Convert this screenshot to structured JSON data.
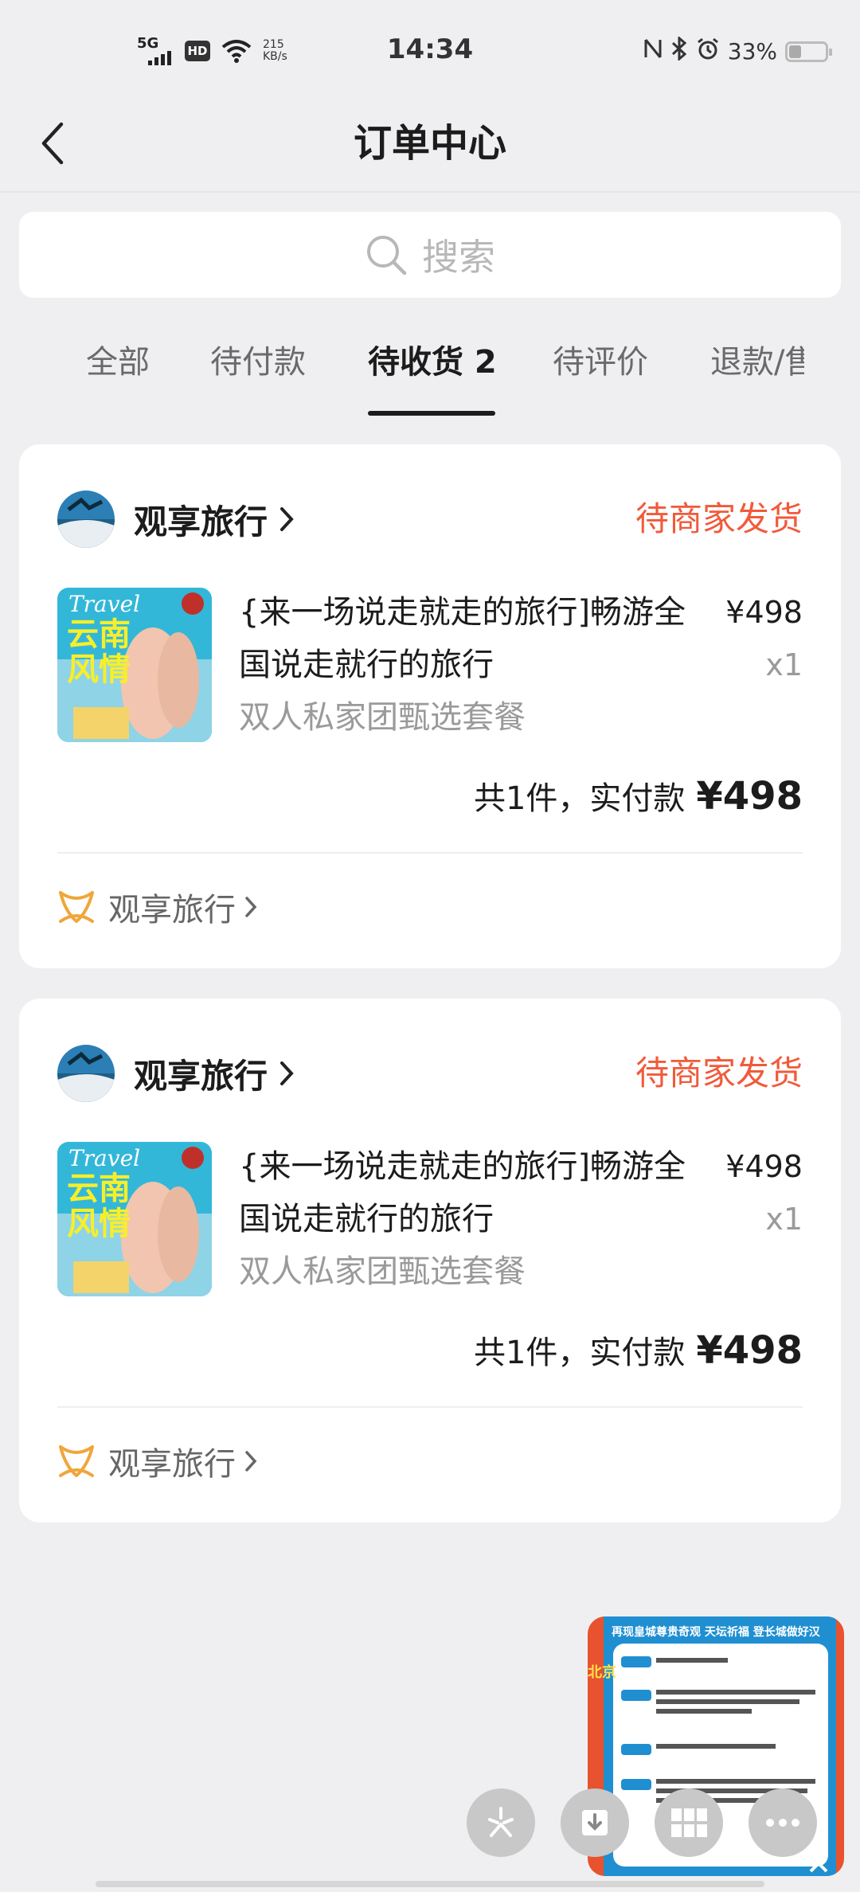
{
  "status_bar": {
    "network": "5G",
    "hd": "HD",
    "speed_value": "215",
    "speed_unit": "KB/s",
    "time": "14:34",
    "battery_text": "33%",
    "battery_level": 0.33
  },
  "nav": {
    "title": "订单中心"
  },
  "search": {
    "placeholder": "搜索"
  },
  "tabs": [
    {
      "label": "全部"
    },
    {
      "label": "待付款"
    },
    {
      "label": "待收货 2",
      "active": true
    },
    {
      "label": "待评价"
    },
    {
      "label": "退款/售后"
    }
  ],
  "orders": [
    {
      "shop_name": "观享旅行",
      "status": "待商家发货",
      "thumb_text_top": "Travel",
      "thumb_text_main_1": "云南",
      "thumb_text_main_2": "风情",
      "product_name": "{来一场说走就走的旅行]畅游全国说走就行的旅行",
      "product_spec": "双人私家团甄选套餐",
      "unit_price": "¥498",
      "quantity": "x1",
      "total_label": "共1件，实付款",
      "total_price": "¥498",
      "brand_name": "观享旅行"
    },
    {
      "shop_name": "观享旅行",
      "status": "待商家发货",
      "thumb_text_top": "Travel",
      "thumb_text_main_1": "云南",
      "thumb_text_main_2": "风情",
      "product_name": "{来一场说走就走的旅行]畅游全国说走就行的旅行",
      "product_spec": "双人私家团甄选套餐",
      "unit_price": "¥498",
      "quantity": "x1",
      "total_label": "共1件，实付款",
      "total_price": "¥498",
      "brand_name": "观享旅行"
    }
  ],
  "floating_preview": {
    "headline": "再现皇城尊贵奇观 天坛祈福 登长城做好汉",
    "side_tag": "北京"
  },
  "colors": {
    "status_accent": "#f15a3a",
    "brand_icon": "#f0a63a",
    "background": "#efeff1"
  }
}
